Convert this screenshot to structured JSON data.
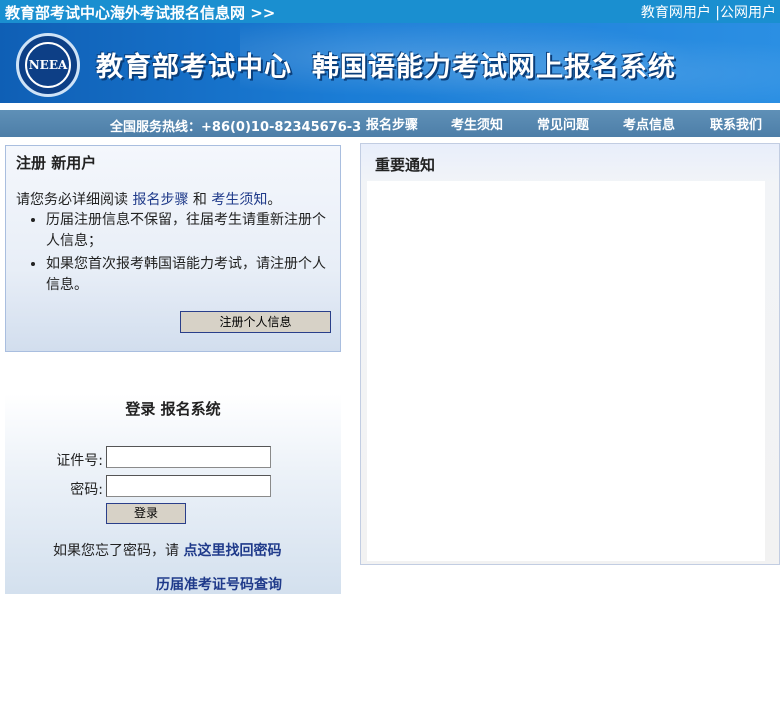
{
  "topbar": {
    "site_name": "教育部考试中心海外考试报名信息网 >>",
    "user_links": [
      "教育网用户",
      "|公网用户"
    ]
  },
  "banner": {
    "logo_text": "NEEA",
    "title_part1": "教育部考试中心",
    "title_part2": "韩国语能力考试网上报名系统"
  },
  "nav": {
    "hotline": "全国服务热线：+86(0)10-82345676-3",
    "links": [
      "报名步骤",
      "考生须知",
      "常见问题",
      "考点信息",
      "联系我们"
    ]
  },
  "register": {
    "heading": "注册 新用户",
    "intro_prefix": "请您务必详细阅读 ",
    "link1": "报名步骤",
    "intro_mid": " 和 ",
    "link2": "考生须知",
    "intro_suffix": "。",
    "bullets": [
      "历届注册信息不保留，往届考生请重新注册个人信息；",
      "如果您首次报考韩国语能力考试，请注册个人信息。"
    ],
    "button": "注册个人信息"
  },
  "login": {
    "heading": "登录 报名系统",
    "id_label": "证件号:",
    "id_value": "",
    "pwd_label": "密码:",
    "pwd_value": "",
    "button": "登录",
    "forgot_prefix": "如果您忘了密码，请 ",
    "forgot_link": "点这里找回密码",
    "history_link": "历届准考证号码查询"
  },
  "notice": {
    "heading": "重要通知"
  }
}
